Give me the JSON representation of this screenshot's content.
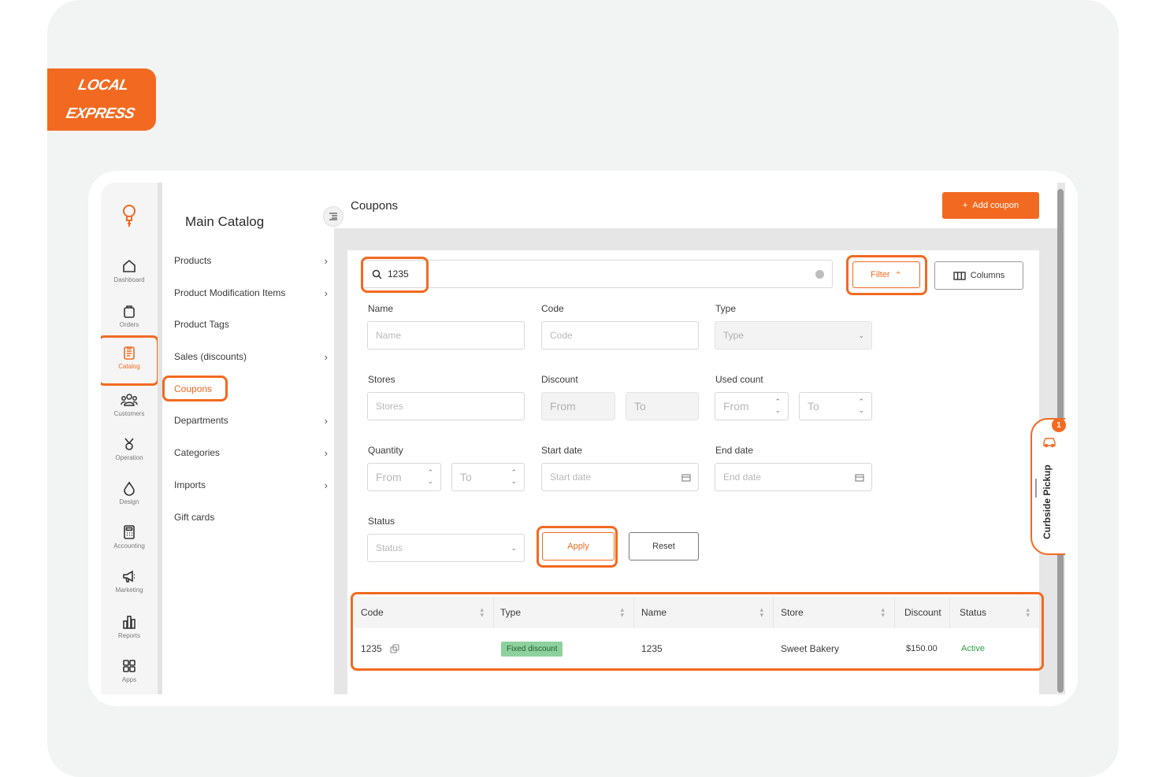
{
  "brand": {
    "logo_line1": "LOCAL",
    "logo_line2": "EXPRESS",
    "accent": "#f26a21"
  },
  "rail": {
    "items": [
      {
        "label": "Dashboard",
        "icon": "home-icon"
      },
      {
        "label": "Orders",
        "icon": "bag-icon"
      },
      {
        "label": "Catalog",
        "icon": "catalog-icon",
        "active": true
      },
      {
        "label": "Customers",
        "icon": "customers-icon"
      },
      {
        "label": "Operation",
        "icon": "operation-icon"
      },
      {
        "label": "Design",
        "icon": "design-icon"
      },
      {
        "label": "Accounting",
        "icon": "calculator-icon"
      },
      {
        "label": "Marketing",
        "icon": "megaphone-icon"
      },
      {
        "label": "Reports",
        "icon": "reports-icon"
      },
      {
        "label": "Apps",
        "icon": "apps-icon"
      }
    ]
  },
  "sidenav": {
    "title": "Main Catalog",
    "items": [
      {
        "label": "Products",
        "chevron": true
      },
      {
        "label": "Product Modification Items",
        "chevron": true
      },
      {
        "label": "Product Tags",
        "chevron": false
      },
      {
        "label": "Sales (discounts)",
        "chevron": true
      },
      {
        "label": "Coupons",
        "chevron": false,
        "active": true
      },
      {
        "label": "Departments",
        "chevron": true
      },
      {
        "label": "Categories",
        "chevron": true
      },
      {
        "label": "Imports",
        "chevron": true
      },
      {
        "label": "Gift cards",
        "chevron": false
      }
    ]
  },
  "header": {
    "title": "Coupons",
    "add_button": "Add coupon"
  },
  "toolbar": {
    "search_value": "1235",
    "filter_label": "Filter",
    "columns_label": "Columns"
  },
  "filters": {
    "name": {
      "label": "Name",
      "placeholder": "Name"
    },
    "code": {
      "label": "Code",
      "placeholder": "Code"
    },
    "type": {
      "label": "Type",
      "placeholder": "Type"
    },
    "stores": {
      "label": "Stores",
      "placeholder": "Stores"
    },
    "discount": {
      "label": "Discount",
      "from": "From",
      "to": "To"
    },
    "used_count": {
      "label": "Used count",
      "from": "From",
      "to": "To"
    },
    "quantity": {
      "label": "Quantity",
      "from": "From",
      "to": "To"
    },
    "start_date": {
      "label": "Start date",
      "placeholder": "Start date"
    },
    "end_date": {
      "label": "End date",
      "placeholder": "End date"
    },
    "status": {
      "label": "Status",
      "placeholder": "Status"
    },
    "apply_label": "Apply",
    "reset_label": "Reset"
  },
  "table": {
    "columns": [
      "Code",
      "Type",
      "Name",
      "Store",
      "Discount",
      "Status"
    ],
    "rows": [
      {
        "code": "1235",
        "type": "Fixed discount",
        "name": "1235",
        "store": "Sweet Bakery",
        "discount": "$150.00",
        "status": "Active"
      }
    ]
  },
  "curbside": {
    "label": "Curbside Pickup",
    "count": "1"
  }
}
